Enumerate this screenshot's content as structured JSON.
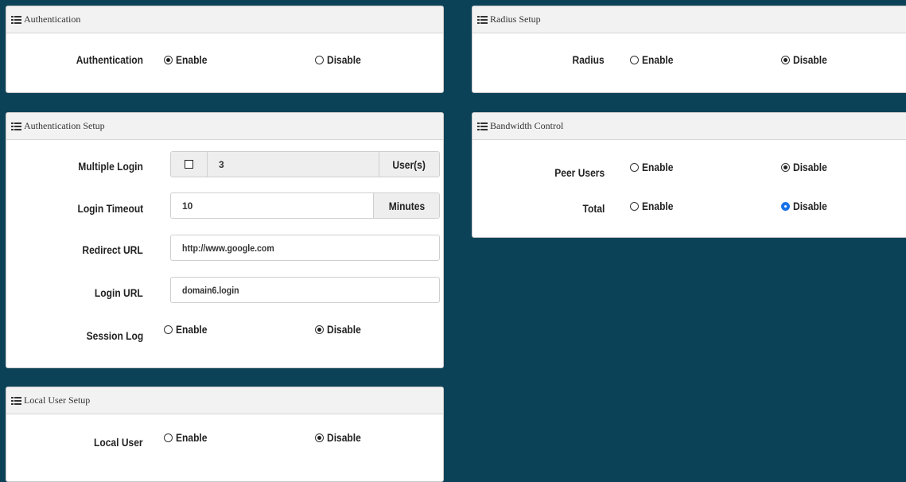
{
  "authentication": {
    "title": "Authentication",
    "label": "Authentication",
    "enable": "Enable",
    "disable": "Disable",
    "selected": "Enable"
  },
  "radius_setup": {
    "title": "Radius Setup",
    "label": "Radius",
    "enable": "Enable",
    "disable": "Disable",
    "selected": "Disable"
  },
  "auth_setup": {
    "title": "Authentication Setup",
    "multiple_login": {
      "label": "Multiple Login",
      "value": "3",
      "unit": "User(s)",
      "checked": false
    },
    "login_timeout": {
      "label": "Login Timeout",
      "value": "10",
      "unit": "Minutes"
    },
    "redirect_url": {
      "label": "Redirect URL",
      "value": "http://www.google.com"
    },
    "login_url": {
      "label": "Login URL",
      "value": "domain6.login"
    },
    "session_log": {
      "label": "Session Log",
      "enable": "Enable",
      "disable": "Disable",
      "selected": "Disable"
    }
  },
  "bandwidth": {
    "title": "Bandwidth Control",
    "peer_users": {
      "label": "Peer Users",
      "enable": "Enable",
      "disable": "Disable",
      "selected": "Disable"
    },
    "total": {
      "label": "Total",
      "enable": "Enable",
      "disable": "Disable",
      "selected": "Disable"
    }
  },
  "local_user": {
    "title": "Local User Setup",
    "label": "Local User",
    "enable": "Enable",
    "disable": "Disable",
    "selected": "Disable"
  },
  "colors": {
    "background": "#0c4257",
    "focus_radio": "#1a73e8"
  }
}
